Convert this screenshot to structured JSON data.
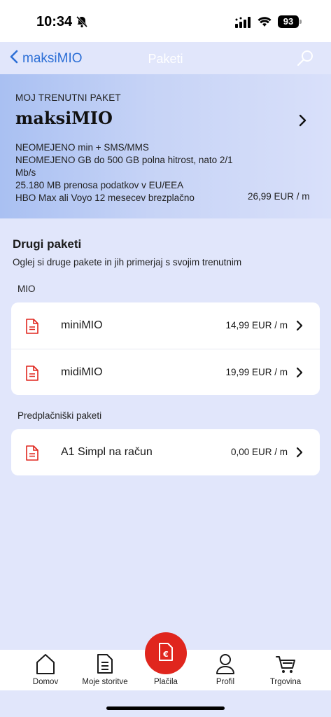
{
  "status": {
    "time": "10:34",
    "battery": "93"
  },
  "nav": {
    "back_label": "maksiMIO",
    "title": "Paketi"
  },
  "current": {
    "label": "MOJ TRENUTNI PAKET",
    "name": "maksiMIO",
    "features": [
      "NEOMEJENO min + SMS/MMS",
      "NEOMEJENO GB do 500 GB polna hitrost, nato 2/1 Mb/s",
      "25.180 MB prenosa podatkov v EU/EEA",
      "HBO Max ali Voyo 12 mesecev brezplačno"
    ],
    "price": "26,99 EUR / m"
  },
  "other": {
    "title": "Drugi paketi",
    "subtitle": "Oglej si druge pakete in jih primerjaj s svojim trenutnim",
    "groups": [
      {
        "label": "MIO",
        "items": [
          {
            "name": "miniMIO",
            "price": "14,99 EUR / m"
          },
          {
            "name": "midiMIO",
            "price": "19,99 EUR / m"
          }
        ]
      },
      {
        "label": "Predplačniški paketi",
        "items": [
          {
            "name": "A1 Simpl na račun",
            "price": "0,00 EUR / m"
          }
        ]
      }
    ]
  },
  "tabs": [
    {
      "label": "Domov",
      "icon": "home-icon"
    },
    {
      "label": "Moje storitve",
      "icon": "services-icon"
    },
    {
      "label": "Plačila",
      "icon": "euro-invoice-icon"
    },
    {
      "label": "Profil",
      "icon": "profile-icon"
    },
    {
      "label": "Trgovina",
      "icon": "cart-icon"
    }
  ],
  "colors": {
    "accent": "#2c6fd6",
    "brand_red": "#e0261e",
    "background": "#e1e6fb"
  }
}
